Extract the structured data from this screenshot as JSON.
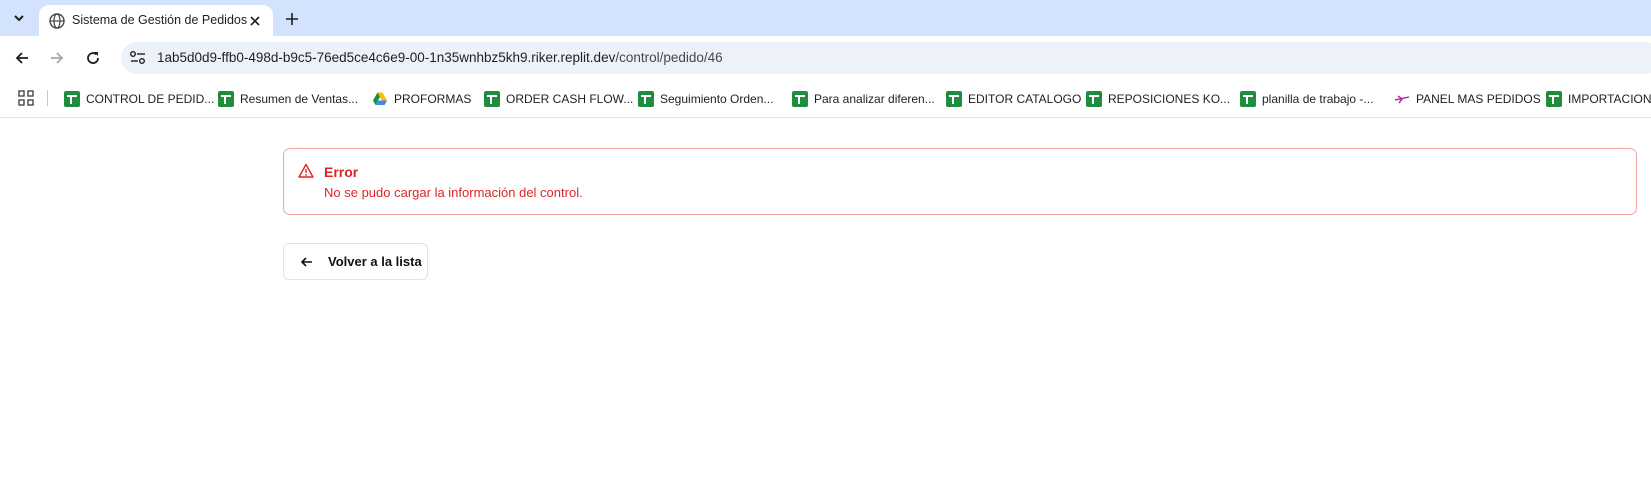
{
  "browser": {
    "tab": {
      "title": "Sistema de Gestión de Pedidos"
    },
    "url": {
      "host": "1ab5d0d9-ffb0-498d-b9c5-76ed5ce4c6e9-00-1n35wnhbz5kh9.riker.replit.dev",
      "path": "/control/pedido/46"
    },
    "bookmarks": [
      {
        "label": "CONTROL DE PEDID...",
        "icon": "sheets-icon"
      },
      {
        "label": "Resumen de Ventas...",
        "icon": "sheets-icon"
      },
      {
        "label": "PROFORMAS",
        "icon": "drive-icon"
      },
      {
        "label": "ORDER CASH FLOW...",
        "icon": "sheets-icon"
      },
      {
        "label": "Seguimiento Orden...",
        "icon": "sheets-icon"
      },
      {
        "label": "Para analizar diferen...",
        "icon": "sheets-icon"
      },
      {
        "label": "EDITOR CATALOGO",
        "icon": "sheets-icon"
      },
      {
        "label": "REPOSICIONES KO...",
        "icon": "sheets-icon"
      },
      {
        "label": "planilla de trabajo -...",
        "icon": "sheets-icon"
      },
      {
        "label": "PANEL MAS PEDIDOS",
        "icon": "plane-icon"
      },
      {
        "label": "IMPORTACIONES",
        "icon": "sheets-icon"
      }
    ]
  },
  "alert": {
    "title": "Error",
    "message": "No se pudo cargar la información del control.",
    "color": "#dc2626"
  },
  "actions": {
    "back_label": "Volver a la lista"
  }
}
